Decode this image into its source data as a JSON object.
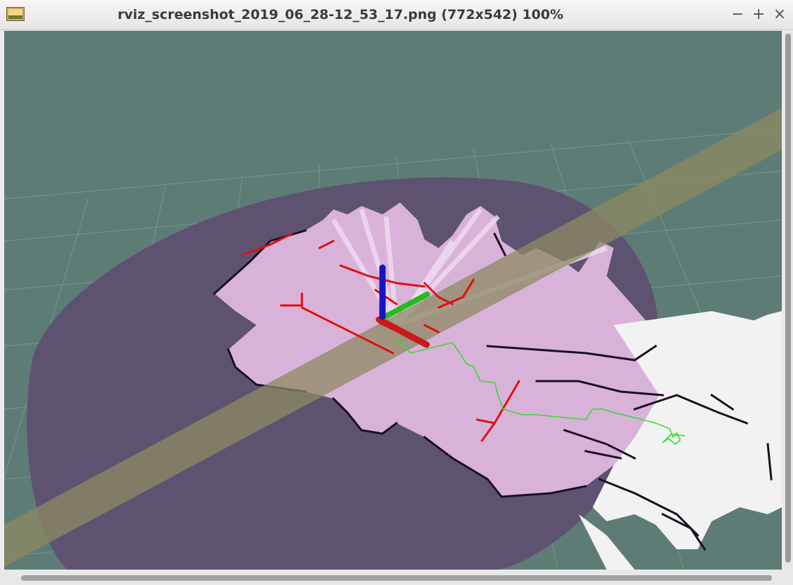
{
  "window": {
    "title": "rviz_screenshot_2019_06_28-12_53_17.png (772x542) 100%",
    "minimize_label": "−",
    "maximize_label": "+",
    "close_label": "×",
    "app_icon": "image-viewer-icon"
  },
  "scene": {
    "background_color": "#5e7c76",
    "costmap_color": "#5d4f71",
    "laser_region_color": "#d9b2d9",
    "path_band_color": "#8c8a61",
    "axes_colors": {
      "x": "#cc1a1a",
      "y": "#22bb22",
      "z": "#1515c0"
    },
    "trajectory_color": "#33dd33",
    "laser_hits_color": "#e01010"
  }
}
